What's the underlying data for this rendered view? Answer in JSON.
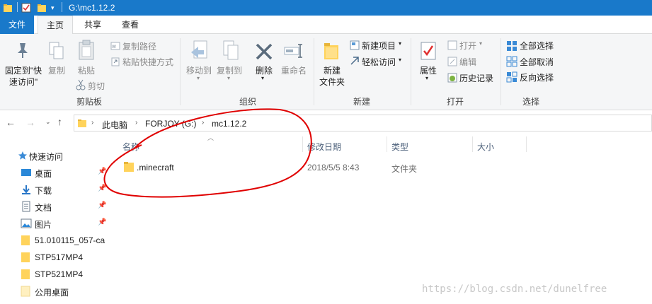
{
  "window": {
    "title": "G:\\mc1.12.2"
  },
  "tabs": [
    {
      "label": "文件"
    },
    {
      "label": "主页"
    },
    {
      "label": "共享"
    },
    {
      "label": "查看"
    }
  ],
  "ribbon": {
    "clipboard": {
      "pin_label_1": "固定到\"快",
      "pin_label_2": "速访问\"",
      "copy": "复制",
      "paste": "粘贴",
      "copy_path": "复制路径",
      "paste_shortcut": "粘贴快捷方式",
      "cut": "剪切",
      "group": "剪贴板"
    },
    "organize": {
      "move_to": "移动到",
      "copy_to": "复制到",
      "delete": "删除",
      "rename": "重命名",
      "group": "组织"
    },
    "new": {
      "new_folder_1": "新建",
      "new_folder_2": "文件夹",
      "new_item": "新建项目",
      "easy_access": "轻松访问",
      "group": "新建"
    },
    "open": {
      "properties": "属性",
      "open": "打开",
      "edit": "编辑",
      "history": "历史记录",
      "group": "打开"
    },
    "select": {
      "select_all": "全部选择",
      "select_none": "全部取消",
      "invert": "反向选择",
      "group": "选择"
    }
  },
  "address": {
    "crumbs": [
      "此电脑",
      "FORJOY (G:)",
      "mc1.12.2"
    ]
  },
  "nav": {
    "quick_access": "快速访问",
    "items": [
      {
        "label": "桌面",
        "icon": "desktop-icon",
        "pinned": true
      },
      {
        "label": "下载",
        "icon": "download-icon",
        "pinned": true
      },
      {
        "label": "文档",
        "icon": "document-icon",
        "pinned": true
      },
      {
        "label": "图片",
        "icon": "picture-icon",
        "pinned": true
      },
      {
        "label": "51.010115_057-ca",
        "icon": "folder-icon",
        "pinned": false
      },
      {
        "label": "STP517MP4",
        "icon": "folder-icon",
        "pinned": false
      },
      {
        "label": "STP521MP4",
        "icon": "folder-icon",
        "pinned": false
      },
      {
        "label": "公用桌面",
        "icon": "folder-icon",
        "pinned": false
      }
    ]
  },
  "columns": {
    "name": "名称",
    "date": "修改日期",
    "type": "类型",
    "size": "大小"
  },
  "files": [
    {
      "name": ".minecraft",
      "date": "2018/5/5 8:43",
      "type": "文件夹"
    }
  ],
  "watermark": "https://blog.csdn.net/dunelfree",
  "colors": {
    "accent": "#1979ca",
    "annotation": "#e00000",
    "folder": "#ffd35b"
  }
}
